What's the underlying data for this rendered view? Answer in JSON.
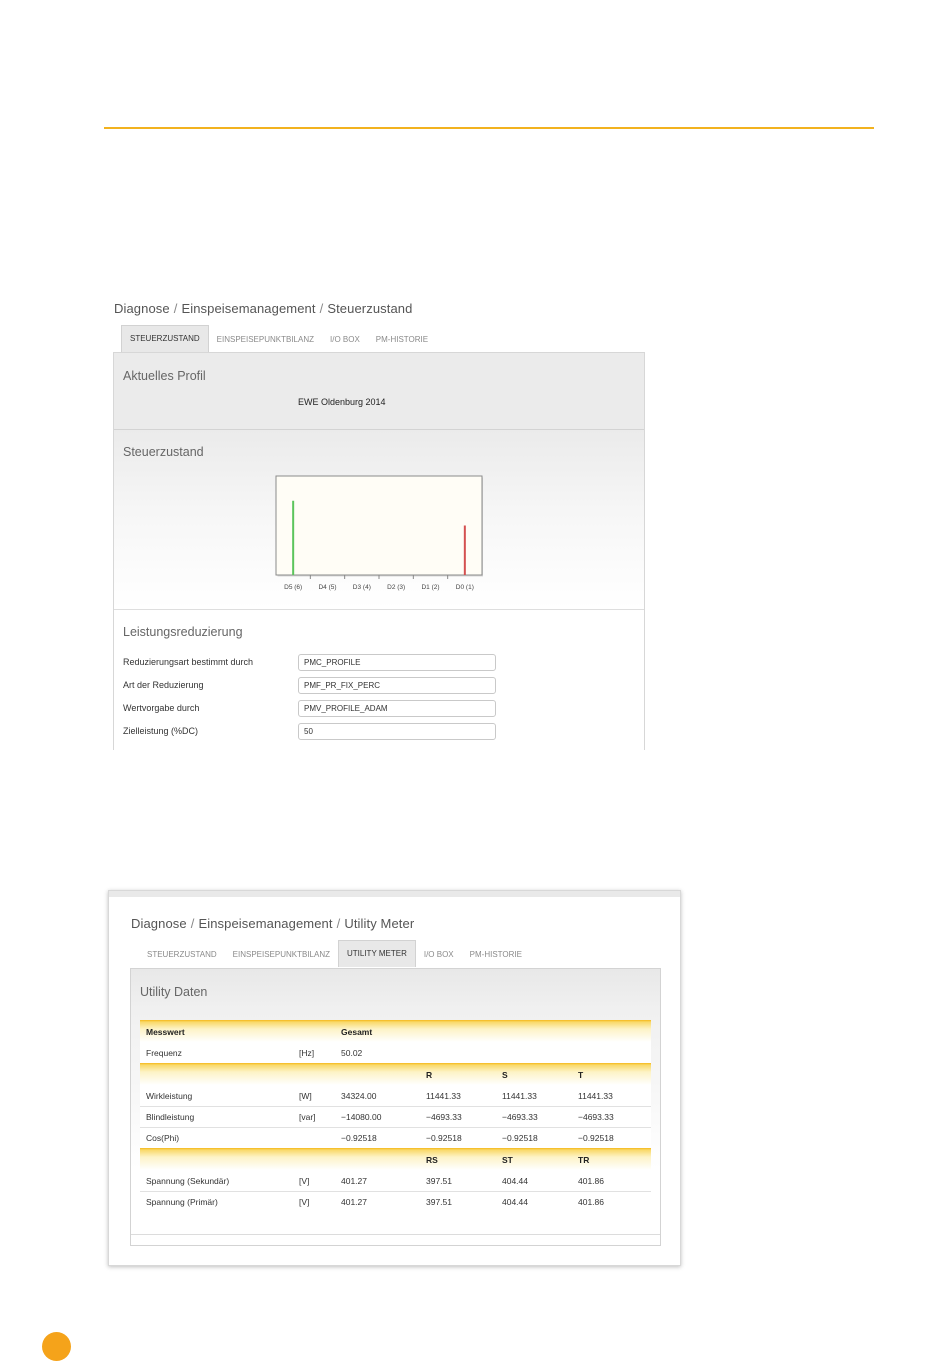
{
  "screen1": {
    "breadcrumb": [
      "Diagnose",
      "Einspeisemanagement",
      "Steuerzustand"
    ],
    "tabs": [
      {
        "label": "STEUERZUSTAND",
        "active": true
      },
      {
        "label": "EINSPEISEPUNKTBILANZ",
        "active": false
      },
      {
        "label": "I/O BOX",
        "active": false
      },
      {
        "label": "PM-HISTORIE",
        "active": false
      }
    ],
    "profile": {
      "title": "Aktuelles Profil",
      "value": "EWE Oldenburg 2014"
    },
    "state": {
      "title": "Steuerzustand"
    },
    "reduction": {
      "title": "Leistungsreduzierung",
      "fields": [
        {
          "label": "Reduzierungsart bestimmt durch",
          "value": "PMC_PROFILE"
        },
        {
          "label": "Art der Reduzierung",
          "value": "PMF_PR_FIX_PERC"
        },
        {
          "label": "Wertvorgabe durch",
          "value": "PMV_PROFILE_ADAM"
        },
        {
          "label": "Zielleistung (%DC)",
          "value": "50"
        }
      ]
    }
  },
  "chart_data": {
    "type": "bar",
    "categories": [
      "D5 (6)",
      "D4 (5)",
      "D3 (4)",
      "D2 (3)",
      "D1 (2)",
      "D0 (1)"
    ],
    "values": [
      0.75,
      0,
      0,
      0,
      0,
      0.5
    ],
    "ylim": [
      0,
      1
    ],
    "bar_colors": [
      "#5cc45c",
      "#c0c0c0",
      "#c0c0c0",
      "#c0c0c0",
      "#c0c0c0",
      "#d45050"
    ],
    "grid": false,
    "background": "#fffdf6"
  },
  "screen2": {
    "breadcrumb": [
      "Diagnose",
      "Einspeisemanagement",
      "Utility Meter"
    ],
    "tabs": [
      {
        "label": "STEUERZUSTAND",
        "active": false
      },
      {
        "label": "EINSPEISEPUNKTBILANZ",
        "active": false
      },
      {
        "label": "UTILITY METER",
        "active": true
      },
      {
        "label": "I/O BOX",
        "active": false
      },
      {
        "label": "PM-HISTORIE",
        "active": false
      }
    ],
    "section_title": "Utility Daten",
    "table": {
      "header1": [
        "Messwert",
        "",
        "Gesamt",
        "",
        "",
        ""
      ],
      "row_freq": [
        "Frequenz",
        "[Hz]",
        "50.02",
        "",
        "",
        ""
      ],
      "header2": [
        "",
        "",
        "",
        "R",
        "S",
        "T"
      ],
      "rows_power": [
        [
          "Wirkleistung",
          "[W]",
          "34324.00",
          "11441.33",
          "11441.33",
          "11441.33"
        ],
        [
          "Blindleistung",
          "[var]",
          "−14080.00",
          "−4693.33",
          "−4693.33",
          "−4693.33"
        ],
        [
          "Cos(Phi)",
          "",
          "−0.92518",
          "−0.92518",
          "−0.92518",
          "−0.92518"
        ]
      ],
      "header3": [
        "",
        "",
        "",
        "RS",
        "ST",
        "TR"
      ],
      "rows_voltage": [
        [
          "Spannung (Sekundär)",
          "[V]",
          "401.27",
          "397.51",
          "404.44",
          "401.86"
        ],
        [
          "Spannung (Primär)",
          "[V]",
          "401.27",
          "397.51",
          "404.44",
          "401.86"
        ]
      ]
    }
  },
  "colors": {
    "accent": "#f2b21f",
    "page_dot": "#f5a31a"
  }
}
